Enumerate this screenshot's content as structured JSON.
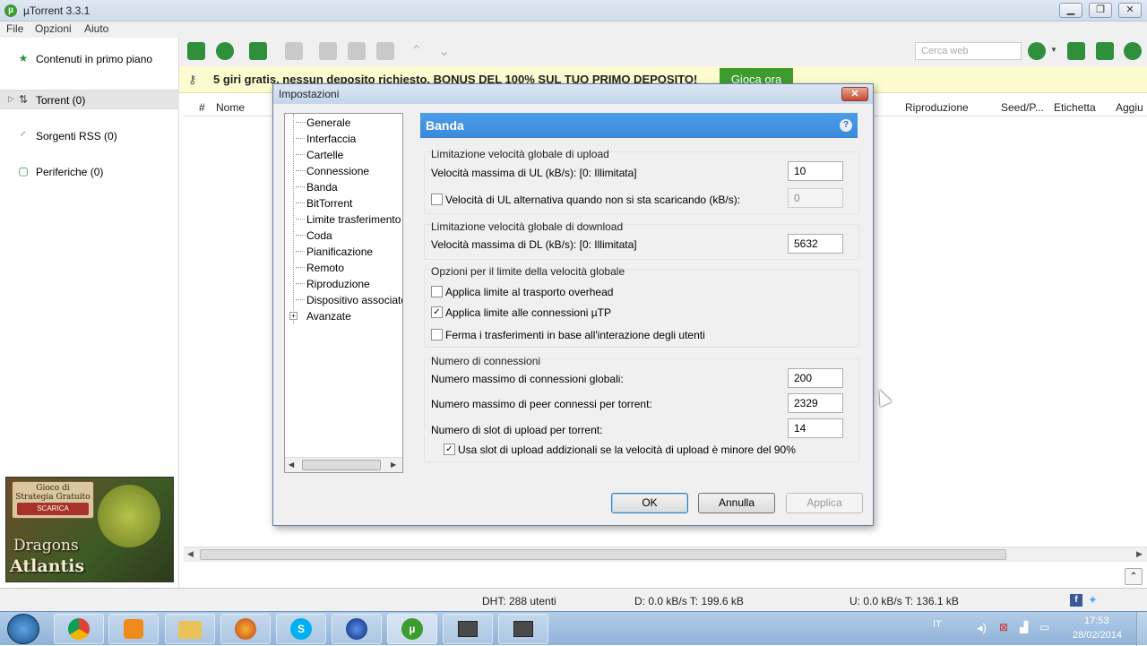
{
  "window": {
    "title": "µTorrent 3.3.1"
  },
  "menu": {
    "file": "File",
    "options": "Opzioni",
    "help": "Aiuto"
  },
  "search": {
    "placeholder": "Cerca web"
  },
  "sidebar": {
    "featured": "Contenuti in primo piano",
    "torrent": "Torrent (0)",
    "rss": "Sorgenti RSS (0)",
    "devices": "Periferiche (0)"
  },
  "ad": {
    "line1": "Gioco di",
    "line2": "Strategia Gratuito",
    "button": "SCARICA",
    "brand1": "Dragons",
    "brand2": "Atlantis"
  },
  "banner": {
    "text": "5 giri gratis, nessun deposito richiesto. BONUS DEL 100% SUL TUO PRIMO DEPOSITO!",
    "cta": "Gioca ora"
  },
  "list": {
    "columns": {
      "num": "#",
      "name": "Nome",
      "playback": "Riproduzione",
      "seeds": "Seed/P...",
      "label": "Etichetta",
      "added": "Aggiu"
    }
  },
  "status": {
    "dht": "DHT: 288 utenti",
    "down": "D: 0.0 kB/s T: 199.6 kB",
    "up": "U: 0.0 kB/s T: 136.1 kB"
  },
  "taskbar": {
    "lang": "IT",
    "time": "17:53",
    "date": "28/02/2014"
  },
  "dialog": {
    "title": "Impostazioni",
    "tree": [
      "Generale",
      "Interfaccia",
      "Cartelle",
      "Connessione",
      "Banda",
      "BitTorrent",
      "Limite trasferimento",
      "Coda",
      "Pianificazione",
      "Remoto",
      "Riproduzione",
      "Dispositivo associato",
      "Avanzate"
    ],
    "panel_title": "Banda",
    "upload": {
      "group": "Limitazione velocità globale di upload",
      "max_label": "Velocità massima di UL (kB/s): [0: Illimitata]",
      "max_value": "10",
      "alt_label": "Velocità di UL alternativa quando non si sta scaricando (kB/s):",
      "alt_value": "0",
      "alt_checked": false
    },
    "download": {
      "group": "Limitazione velocità globale di download",
      "max_label": "Velocità massima di DL (kB/s): [0: Illimitata]",
      "max_value": "5632"
    },
    "options": {
      "group": "Opzioni per il limite della velocità globale",
      "overhead": "Applica limite al trasporto overhead",
      "overhead_checked": false,
      "utp": "Applica limite alle connessioni µTP",
      "utp_checked": true,
      "stop": "Ferma i trasferimenti in base all'interazione degli utenti",
      "stop_checked": false
    },
    "connections": {
      "group": "Numero di connessioni",
      "global_label": "Numero massimo di connessioni globali:",
      "global_value": "200",
      "peers_label": "Numero massimo di peer connessi per torrent:",
      "peers_value": "2329",
      "slots_label": "Numero di slot di upload per torrent:",
      "slots_value": "14",
      "extra_label": "Usa slot di upload addizionali se la velocità di upload è minore del 90%",
      "extra_checked": true
    },
    "buttons": {
      "ok": "OK",
      "cancel": "Annulla",
      "apply": "Applica"
    }
  },
  "colors": {
    "accent": "#3a8ad9",
    "toolbar_green": "#2f8f3a",
    "banner_bg": "#fcfcd0"
  }
}
